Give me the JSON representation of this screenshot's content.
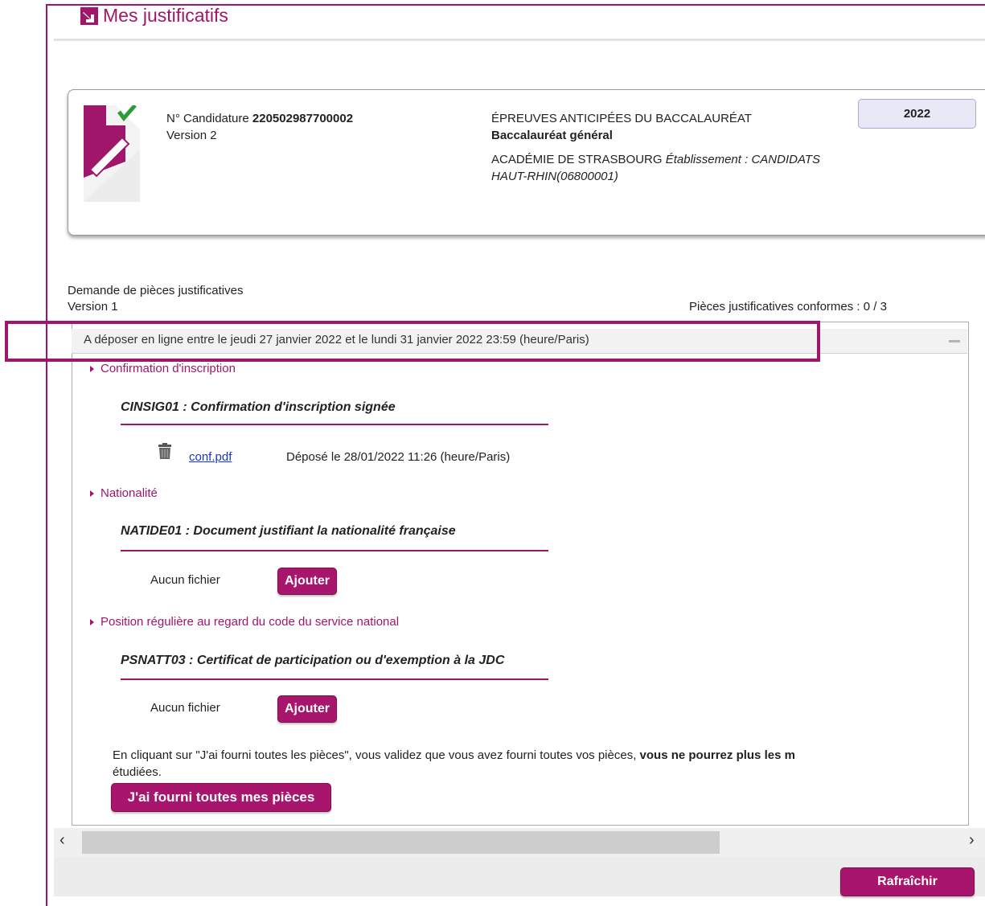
{
  "header": {
    "title": "Mes justificatifs"
  },
  "candidate": {
    "number_label": "N° Candidature",
    "number": "220502987700002",
    "version": "Version 2",
    "exam_title": "ÉPREUVES ANTICIPÉES DU BACCALAURÉAT",
    "exam_subtitle": "Baccalauréat général",
    "academy": "ACADÉMIE DE STRASBOURG",
    "establishment_label": "Établissement :",
    "establishment": "CANDIDATS HAUT-RHIN(06800001)",
    "year": "2022"
  },
  "request": {
    "title": "Demande de pièces justificatives",
    "version": "Version 1",
    "conformes": "Pièces justificatives conformes : 0 / 3",
    "deadline": "A déposer en ligne entre le jeudi 27 janvier 2022 et le lundi 31 janvier 2022 23:59 (heure/Paris)"
  },
  "sections": [
    {
      "title": "Confirmation d'inscription",
      "piece": "CINSIG01 : Confirmation d'inscription signée",
      "file": "conf.pdf",
      "file_date": "Déposé le 28/01/2022 11:26 (heure/Paris)"
    },
    {
      "title": "Nationalité",
      "piece": "NATIDE01 : Document justifiant la nationalité française",
      "no_file": "Aucun fichier",
      "button": "Ajouter"
    },
    {
      "title": "Position régulière au regard du code du service national",
      "piece": "PSNATT03 : Certificat de participation ou d'exemption à la JDC",
      "no_file": "Aucun fichier",
      "button": "Ajouter"
    }
  ],
  "notice": {
    "text_start": "En cliquant sur \"J'ai fourni toutes les pièces\", vous validez que vous avez fourni toutes vos pièces, ",
    "text_bold": "vous ne pourrez plus les m",
    "text_line2": "étudiées."
  },
  "buttons": {
    "submit_all": "J'ai fourni toutes mes pièces",
    "refresh": "Rafraîchir"
  },
  "scroll": {
    "left": "‹",
    "right": "›"
  },
  "colors": {
    "accent": "#a0166b",
    "link": "#1a33cc",
    "badge_bg": "#e8e8f6"
  }
}
